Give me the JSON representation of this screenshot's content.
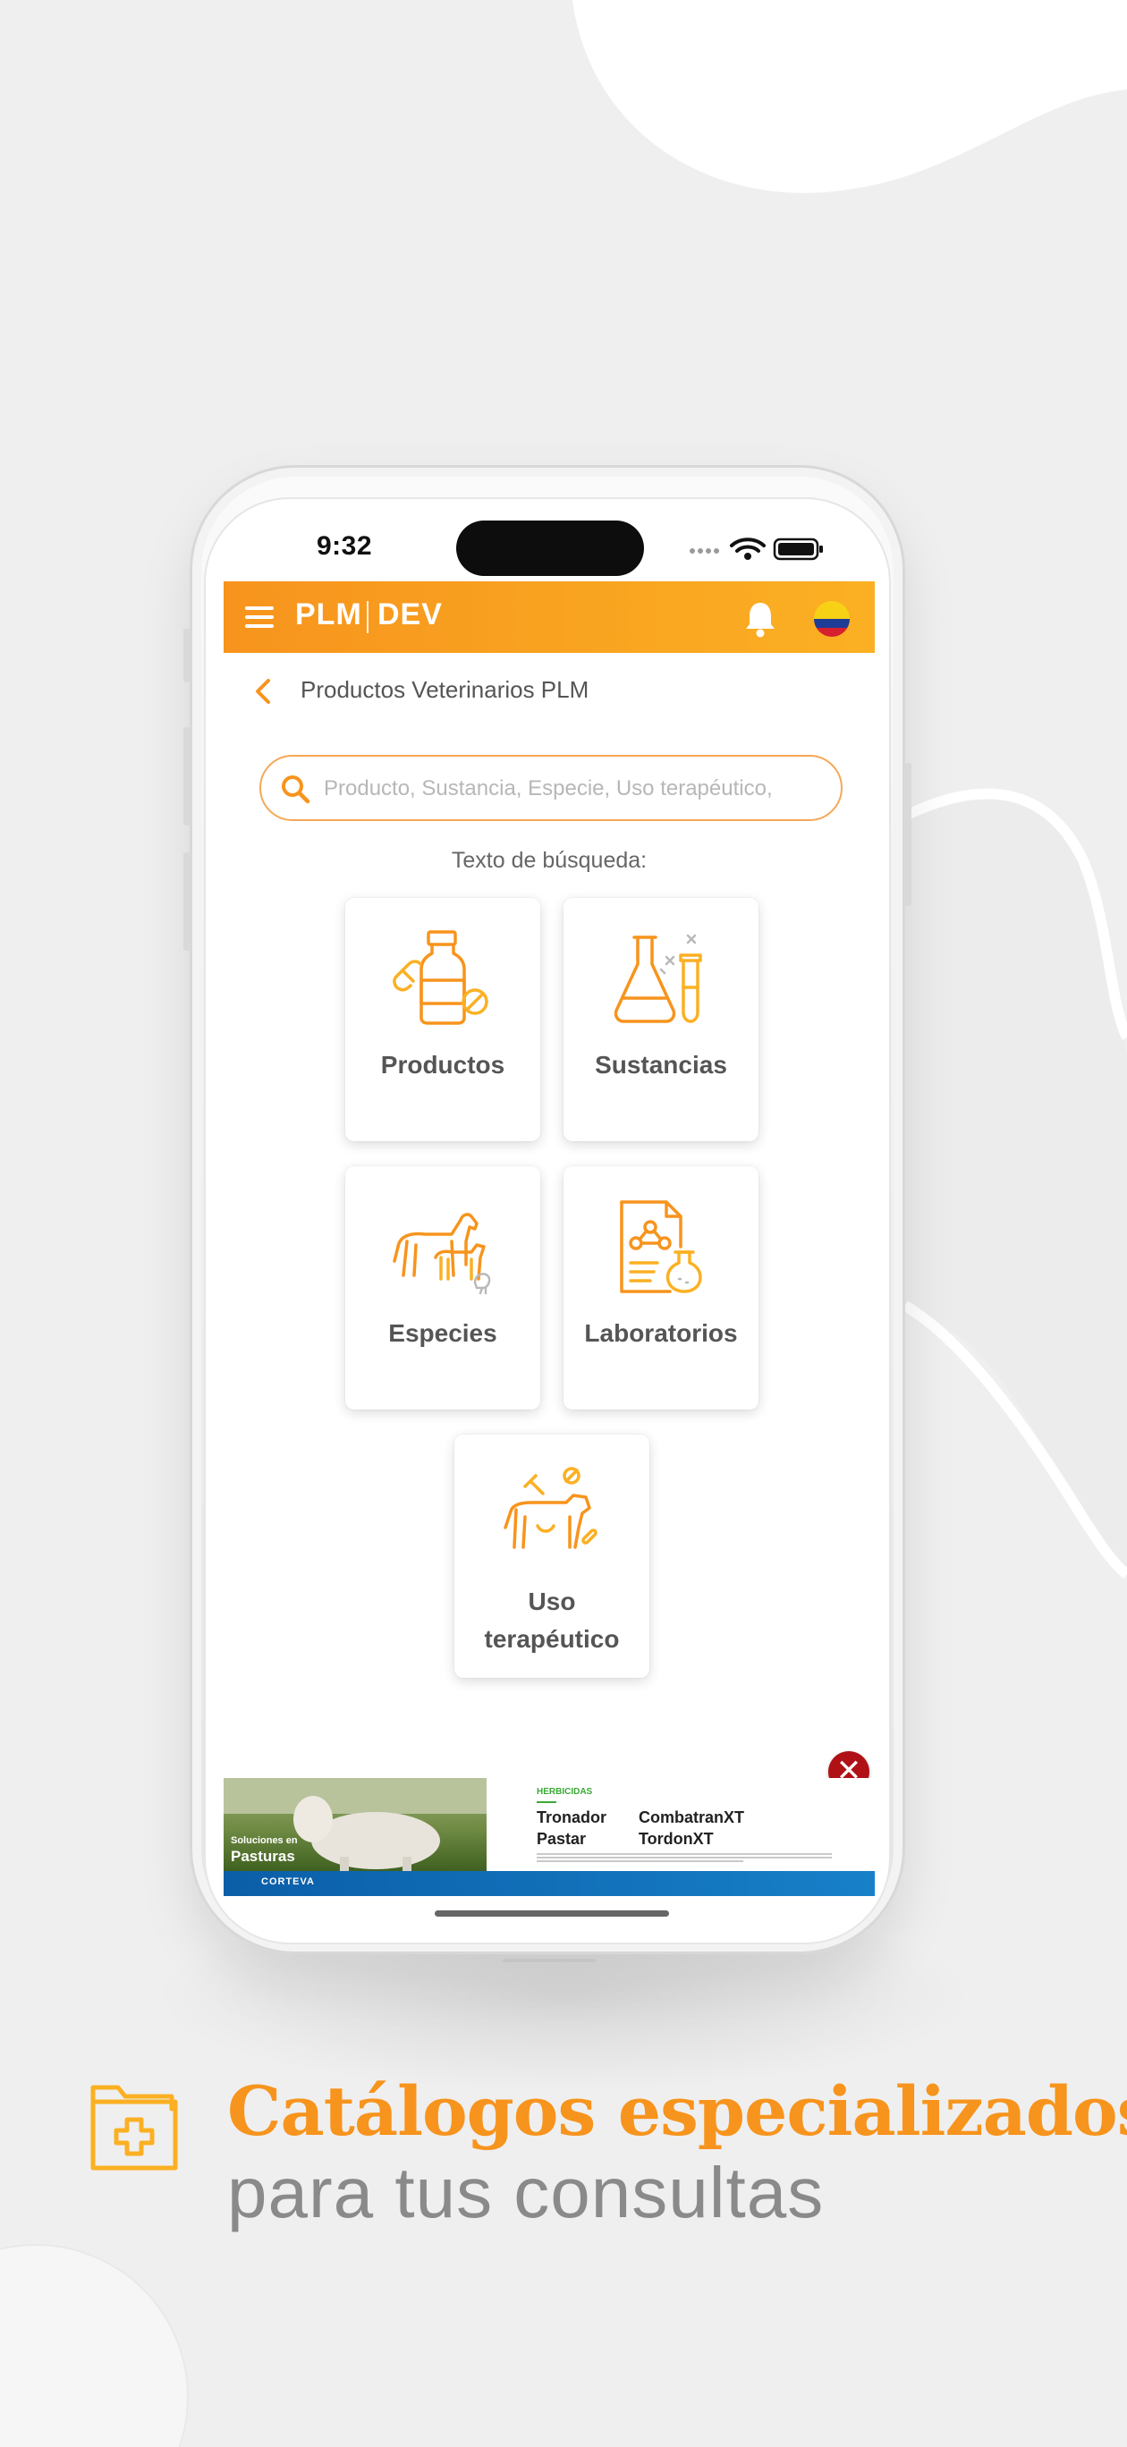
{
  "colors": {
    "accent": "#f7941d",
    "accent_light": "#fbb023",
    "text_gray": "#555555",
    "headline_gray": "#8a8a8a",
    "close_red": "#b01116"
  },
  "status_bar": {
    "time": "9:32"
  },
  "app_bar": {
    "logo": "PLM",
    "env": "DEV",
    "menu_icon": "hamburger-menu-icon",
    "notification_icon": "bell-icon",
    "country_icon": "colombia-flag-icon"
  },
  "header": {
    "title": "Productos Veterinarios PLM"
  },
  "search": {
    "placeholder": "Producto, Sustancia, Especie, Uso terapéutico,",
    "hint": "Texto de búsqueda:"
  },
  "categories": [
    {
      "label": "Productos",
      "icon": "medicine-bottle-icon"
    },
    {
      "label": "Sustancias",
      "icon": "lab-flasks-icon"
    },
    {
      "label": "Especies",
      "icon": "farm-animals-icon"
    },
    {
      "label": "Laboratorios",
      "icon": "lab-document-icon"
    },
    {
      "label": "Uso\nterapéutico",
      "icon": "cow-treatment-icon"
    }
  ],
  "ad": {
    "photo_caption_small": "Soluciones en",
    "photo_caption_big": "Pasturas",
    "tag": "HERBICIDAS",
    "products": [
      "Tronador",
      "CombatranXT",
      "Pastar",
      "TordonXT"
    ],
    "brand": "CORTEVA",
    "close_label": "✕"
  },
  "promo": {
    "headline": "Catálogos especializados",
    "subheadline": "para tus consultas",
    "icon": "medical-folder-icon"
  }
}
